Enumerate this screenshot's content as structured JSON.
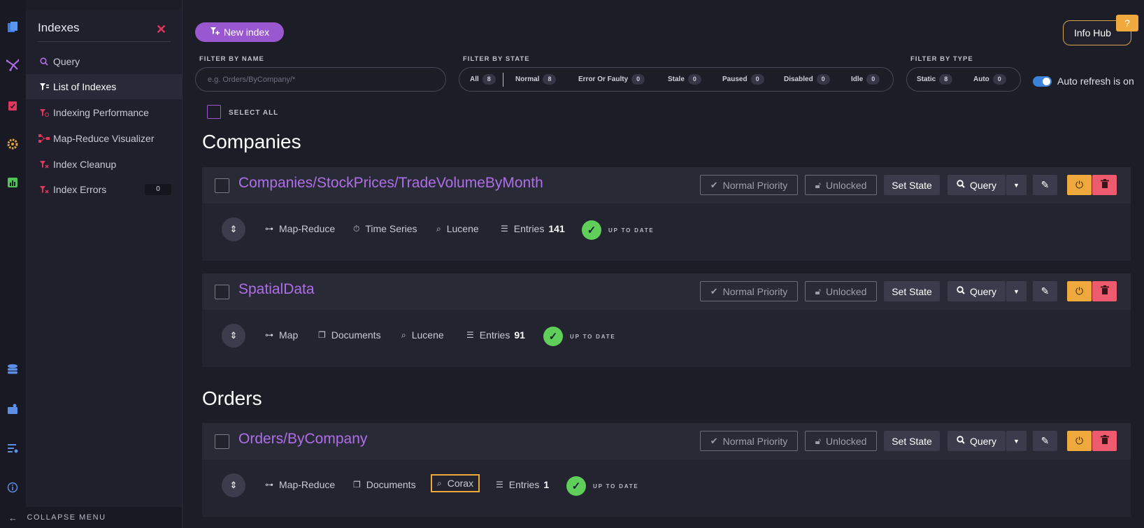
{
  "rail": {
    "icons": [
      "documents-icon",
      "indexes-icon",
      "tasks-icon",
      "settings-icon",
      "stats-icon",
      "databases-icon",
      "manage-server-icon",
      "server-settings-icon",
      "about-icon"
    ]
  },
  "sidebar": {
    "title": "Indexes",
    "items": [
      {
        "label": "Query",
        "icon": "search-icon"
      },
      {
        "label": "List of Indexes",
        "icon": "index-list-icon"
      },
      {
        "label": "Indexing Performance",
        "icon": "performance-icon"
      },
      {
        "label": "Map-Reduce Visualizer",
        "icon": "map-reduce-icon"
      },
      {
        "label": "Index Cleanup",
        "icon": "cleanup-icon"
      },
      {
        "label": "Index Errors",
        "icon": "errors-icon",
        "badge": "0"
      }
    ],
    "collapse_label": "COLLAPSE MENU"
  },
  "toolbar": {
    "new_index_label": "New index",
    "info_hub_label": "Info Hub",
    "info_badge": "?"
  },
  "filters": {
    "name_label": "FILTER BY NAME",
    "name_placeholder": "e.g. Orders/ByCompany/*",
    "state_label": "FILTER BY STATE",
    "states": [
      {
        "label": "All",
        "count": "8"
      },
      {
        "label": "Normal",
        "count": "8"
      },
      {
        "label": "Error Or Faulty",
        "count": "0"
      },
      {
        "label": "Stale",
        "count": "0"
      },
      {
        "label": "Paused",
        "count": "0"
      },
      {
        "label": "Disabled",
        "count": "0"
      },
      {
        "label": "Idle",
        "count": "0"
      }
    ],
    "type_label": "FILTER BY TYPE",
    "types": [
      {
        "label": "Static",
        "count": "8"
      },
      {
        "label": "Auto",
        "count": "0"
      }
    ],
    "auto_refresh_label": "Auto refresh is on",
    "select_all_label": "SELECT ALL"
  },
  "buttons": {
    "priority": "Normal Priority",
    "lock": "Unlocked",
    "set_state": "Set State",
    "query": "Query"
  },
  "status_text": "UP TO DATE",
  "groups": [
    {
      "title": "Companies",
      "indexes": [
        {
          "name": "Companies/StockPrices/TradeVolumeByMonth",
          "kind": "Map-Reduce",
          "source": "Time Series",
          "engine": "Lucene",
          "entries_label": "Entries",
          "entries": "141"
        },
        {
          "name": "SpatialData",
          "kind": "Map",
          "source": "Documents",
          "engine": "Lucene",
          "entries_label": "Entries",
          "entries": "91"
        }
      ]
    },
    {
      "title": "Orders",
      "indexes": [
        {
          "name": "Orders/ByCompany",
          "kind": "Map-Reduce",
          "source": "Documents",
          "engine": "Corax",
          "entries_label": "Entries",
          "entries": "1"
        }
      ]
    }
  ],
  "colors": {
    "accent": "#9a58d0",
    "index_name": "#b06ee8",
    "warning": "#f0a93c",
    "danger": "#ee5a6e",
    "success": "#5fcf5a",
    "toggle": "#3b82d9"
  }
}
